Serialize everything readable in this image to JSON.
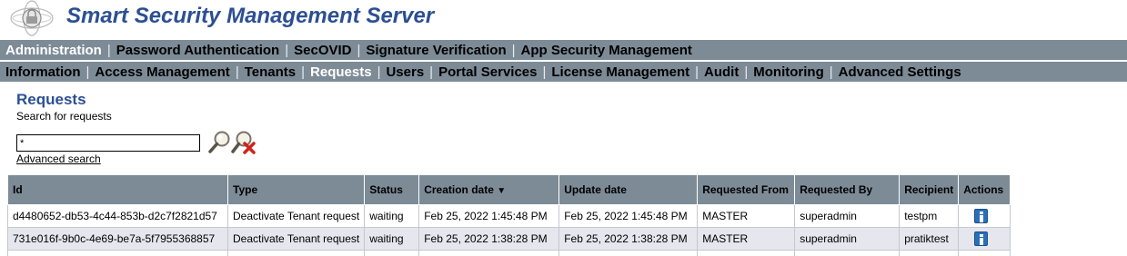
{
  "app": {
    "title": "Smart Security Management Server"
  },
  "nav_primary": [
    {
      "label": "Administration",
      "active": true
    },
    {
      "label": "Password Authentication",
      "active": false
    },
    {
      "label": "SecOVID",
      "active": false
    },
    {
      "label": "Signature Verification",
      "active": false
    },
    {
      "label": "App Security Management",
      "active": false
    }
  ],
  "nav_secondary": [
    {
      "label": "Information",
      "active": false
    },
    {
      "label": "Access Management",
      "active": false
    },
    {
      "label": "Tenants",
      "active": false
    },
    {
      "label": "Requests",
      "active": true
    },
    {
      "label": "Users",
      "active": false
    },
    {
      "label": "Portal Services",
      "active": false
    },
    {
      "label": "License Management",
      "active": false
    },
    {
      "label": "Audit",
      "active": false
    },
    {
      "label": "Monitoring",
      "active": false
    },
    {
      "label": "Advanced Settings",
      "active": false
    }
  ],
  "nav_separator": "|",
  "page": {
    "title": "Requests",
    "subtitle": "Search for requests"
  },
  "search": {
    "value": "*",
    "advanced_link": "Advanced search"
  },
  "table": {
    "columns": [
      "Id",
      "Type",
      "Status",
      "Creation date",
      "Update date",
      "Requested From",
      "Requested By",
      "Recipient",
      "Actions"
    ],
    "sort_indicator": "▼",
    "rows": [
      {
        "id": "d4480652-db53-4c44-853b-d2c7f2821d57",
        "type": "Deactivate Tenant request",
        "status": "waiting",
        "created": "Feb 25, 2022 1:45:48 PM",
        "updated": "Feb 25, 2022 1:45:48 PM",
        "from": "MASTER",
        "by": "superadmin",
        "recipient": "testpm"
      },
      {
        "id": "731e016f-9b0c-4e69-be7a-5f7955368857",
        "type": "Deactivate Tenant request",
        "status": "waiting",
        "created": "Feb 25, 2022 1:38:28 PM",
        "updated": "Feb 25, 2022 1:38:28 PM",
        "from": "MASTER",
        "by": "superadmin",
        "recipient": "pratiktest"
      }
    ]
  },
  "icons": {
    "logo": "globe-lock-icon",
    "search": "magnifier-icon",
    "clear": "magnifier-clear-icon",
    "details": "info-icon"
  },
  "colors": {
    "brand": "#2c4f93",
    "nav_bg": "#7d8b97",
    "nav_active": "#ffffff",
    "row_alt": "#e5e6ee",
    "info": "#2a6fb8",
    "clear_x": "#d0241a"
  }
}
